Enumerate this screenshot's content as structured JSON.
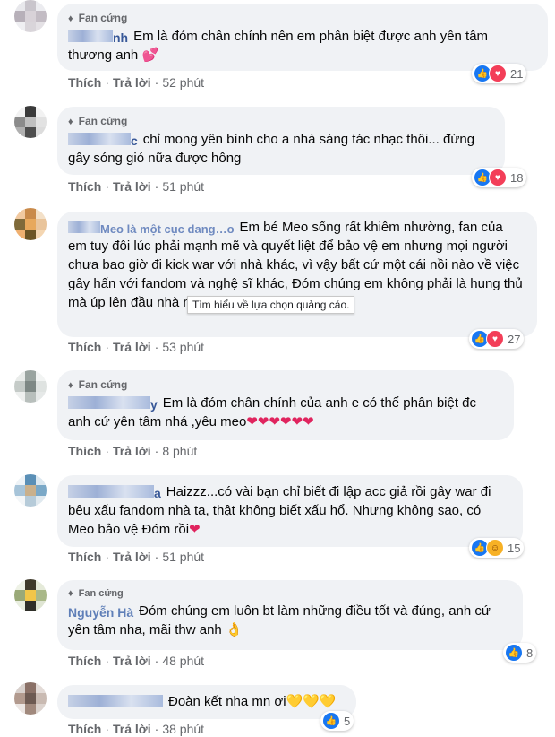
{
  "common": {
    "badge": "Fan cứng",
    "like": "Thích",
    "reply": "Trả lời",
    "sep": "·"
  },
  "comments": [
    {
      "name_tail": "nh",
      "text": "Em là đóm chân chính nên em phân biệt được anh yên tâm thương anh",
      "emoji": "💕",
      "time": "52 phút",
      "count": "21",
      "reactions": [
        "like",
        "love"
      ]
    },
    {
      "name_tail": "c",
      "text": "chỉ mong yên bình cho a nhà sáng tác nhạc thôi... đừng gây sóng gió nữa được hông",
      "emoji": "",
      "time": "51 phút",
      "count": "18",
      "reactions": [
        "like",
        "love"
      ]
    },
    {
      "name_tail": "Meo là một cục dang…o",
      "text": "Em bé Meo sống rất khiêm nhường, fan của em tuy đôi lúc phải mạnh mẽ và quyết liệt để bảo vệ em nhưng mọi người chưa bao giờ đi kick war với nhà khác, vì vậy bất cứ một cái nồi nào về việc gây hấn với fandom và nghệ sĩ khác, Đóm chúng em không phải là hung thủ mà úp lên đầu nhà này",
      "emoji": "",
      "time": "53 phút",
      "count": "27",
      "reactions": [
        "like",
        "love"
      ]
    },
    {
      "name_tail": "y",
      "text": "Em là đóm chân chính của anh e có thể phân biệt đc anh cứ yên tâm nhá ,yêu meo",
      "emoji": "❤❤❤❤❤❤",
      "time": "8 phút",
      "count": "",
      "reactions": []
    },
    {
      "name_tail": "a",
      "text": "Haizzz...có vài bạn chỉ biết đi lập acc giả rồi gây war đi bêu xấu fandom nhà ta, thật không biết xấu hổ. Nhưng không sao, có Meo bảo vệ Đóm rồi",
      "emoji": "❤",
      "time": "51 phút",
      "count": "15",
      "reactions": [
        "like",
        "care"
      ]
    },
    {
      "name_tail": "Nguyễn Hà",
      "text": "Đóm chúng em luôn bt làm những điều tốt và đúng, anh cứ yên tâm nha, mãi thw anh",
      "emoji": "👌",
      "time": "48 phút",
      "count": "8",
      "reactions": [
        "like"
      ]
    },
    {
      "name_tail": "",
      "text": "Đoàn kết nha mn ơi",
      "emoji": "💛💛💛",
      "time": "38 phút",
      "count": "5",
      "reactions": [
        "like"
      ]
    }
  ],
  "tooltip": "Tìm hiểu về lựa chọn quảng cáo.",
  "colors": {
    "bubble": "#f0f2f5",
    "link": "#385898",
    "like": "#1877f2",
    "love": "#f33e58"
  }
}
